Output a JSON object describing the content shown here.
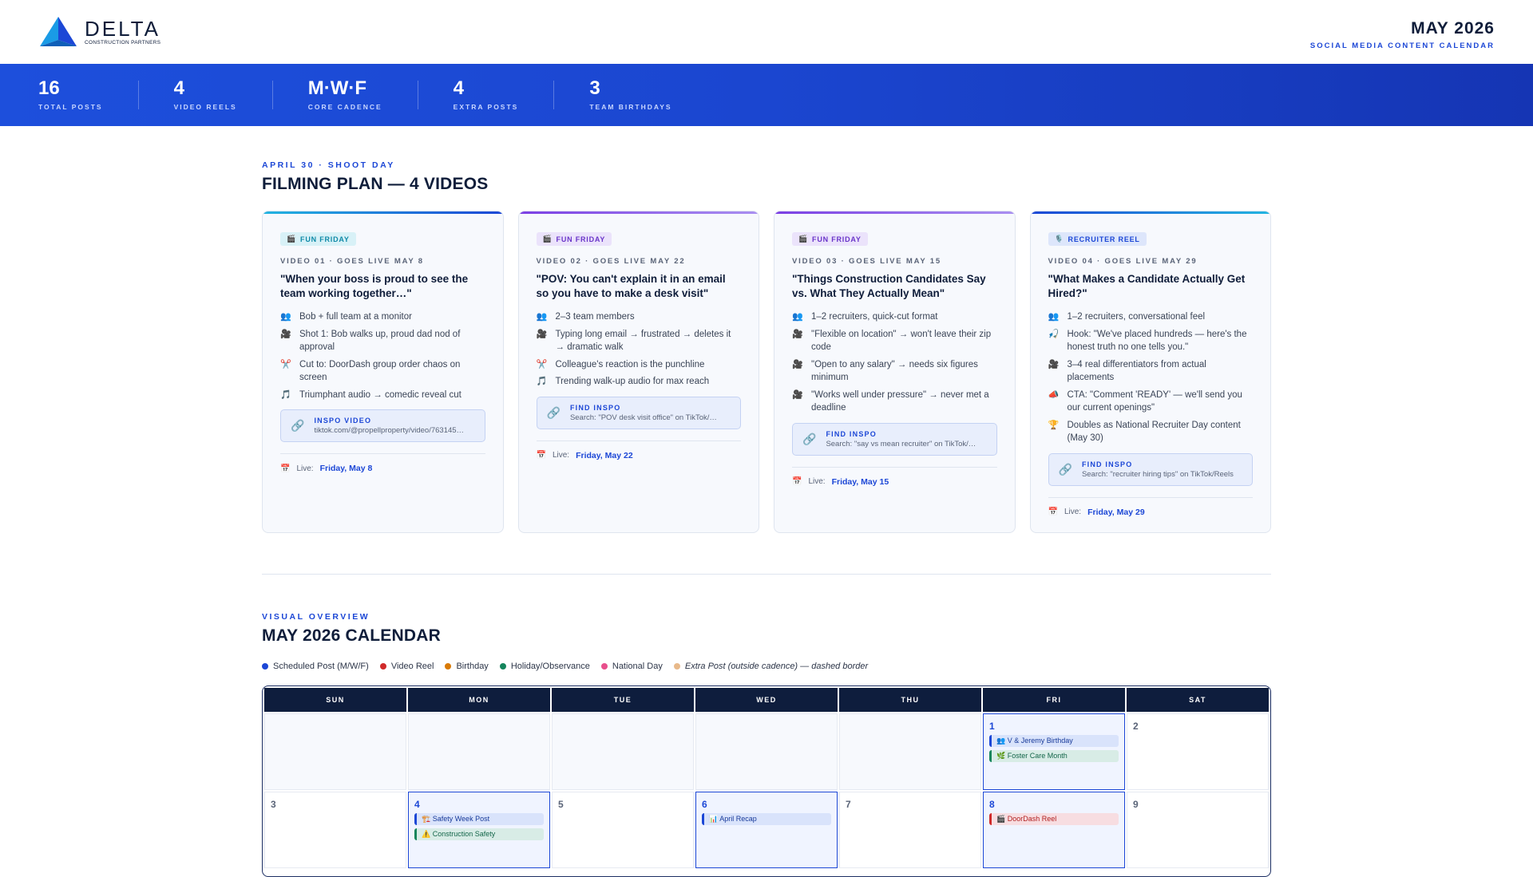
{
  "brand": {
    "name": "DELTA",
    "tagline": "CONSTRUCTION PARTNERS"
  },
  "header": {
    "month": "MAY 2026",
    "subtitle": "SOCIAL MEDIA CONTENT CALENDAR"
  },
  "stats": [
    {
      "value": "16",
      "label": "TOTAL POSTS"
    },
    {
      "value": "4",
      "label": "VIDEO REELS"
    },
    {
      "value": "M·W·F",
      "label": "CORE CADENCE"
    },
    {
      "value": "4",
      "label": "EXTRA POSTS"
    },
    {
      "value": "3",
      "label": "TEAM BIRTHDAYS"
    }
  ],
  "filming": {
    "eyebrow": "APRIL 30 · SHOOT DAY",
    "title": "FILMING PLAN — 4 VIDEOS",
    "live_label": "Live:",
    "cards": [
      {
        "tag": "FUN FRIDAY",
        "meta": "VIDEO 01 · GOES LIVE MAY 8",
        "title": "\"When your boss is proud to see the team working together…\"",
        "bullets": [
          "Bob + full team at a monitor",
          "Shot 1: Bob walks up, proud dad nod of approval",
          "Cut to: DoorDash group order chaos on screen",
          "Triumphant audio → comedic reveal cut"
        ],
        "inspo_label": "INSPO VIDEO",
        "inspo_text": "tiktok.com/@propellproperty/video/763145…",
        "live": "Friday, May 8"
      },
      {
        "tag": "FUN FRIDAY",
        "meta": "VIDEO 02 · GOES LIVE MAY 22",
        "title": "\"POV: You can't explain it in an email so you have to make a desk visit\"",
        "bullets": [
          "2–3 team members",
          "Typing long email → frustrated → deletes it → dramatic walk",
          "Colleague's reaction is the punchline",
          "Trending walk-up audio for max reach"
        ],
        "inspo_label": "FIND INSPO",
        "inspo_text": "Search: \"POV desk visit office\" on TikTok/…",
        "live": "Friday, May 22"
      },
      {
        "tag": "FUN FRIDAY",
        "meta": "VIDEO 03 · GOES LIVE MAY 15",
        "title": "\"Things Construction Candidates Say vs. What They Actually Mean\"",
        "bullets": [
          "1–2 recruiters, quick-cut format",
          "\"Flexible on location\" → won't leave their zip code",
          "\"Open to any salary\" → needs six figures minimum",
          "\"Works well under pressure\" → never met a deadline"
        ],
        "inspo_label": "FIND INSPO",
        "inspo_text": "Search: \"say vs mean recruiter\" on TikTok/…",
        "live": "Friday, May 15"
      },
      {
        "tag": "RECRUITER REEL",
        "meta": "VIDEO 04 · GOES LIVE MAY 29",
        "title": "\"What Makes a Candidate Actually Get Hired?\"",
        "bullets": [
          "1–2 recruiters, conversational feel",
          "Hook: \"We've placed hundreds — here's the honest truth no one tells you.\"",
          "3–4 real differentiators from actual placements",
          "CTA: \"Comment 'READY' — we'll send you our current openings\"",
          "Doubles as National Recruiter Day content (May 30)"
        ],
        "inspo_label": "FIND INSPO",
        "inspo_text": "Search: \"recruiter hiring tips\" on TikTok/Reels",
        "live": "Friday, May 29"
      }
    ]
  },
  "overview": {
    "eyebrow": "VISUAL OVERVIEW",
    "title": "MAY 2026 CALENDAR",
    "legend": [
      {
        "label": "Scheduled Post (M/W/F)",
        "color": "#1c47d6"
      },
      {
        "label": "Video Reel",
        "color": "#d02a2a"
      },
      {
        "label": "Birthday",
        "color": "#d97a06"
      },
      {
        "label": "Holiday/Observance",
        "color": "#14855c"
      },
      {
        "label": "National Day",
        "color": "#e84f8c"
      },
      {
        "label": "Extra Post (outside cadence) — dashed border",
        "color": "#e8b98a"
      }
    ],
    "weekdays": [
      "SUN",
      "MON",
      "TUE",
      "WED",
      "THU",
      "FRI",
      "SAT"
    ],
    "week1": {
      "fri_num": "1",
      "fri_evt1": "👥 V & Jeremy Birthday",
      "fri_evt2": "🌿 Foster Care Month",
      "sat_num": "2"
    },
    "week2": {
      "sun_num": "3",
      "mon_num": "4",
      "mon_evt1": "🏗️ Safety Week Post",
      "mon_evt2": "⚠️ Construction Safety",
      "tue_num": "5",
      "wed_num": "6",
      "wed_evt1": "📊 April Recap",
      "thu_num": "7",
      "fri_num": "8",
      "fri_evt1": "🎬 DoorDash Reel",
      "sat_num": "9"
    }
  },
  "colors": {
    "accent": "#1c47d6",
    "navy": "#0e1d3d",
    "card1_line": "#22b4e0",
    "card2_line": "#7b3fe4",
    "card3_line": "#7b3fe4",
    "card4_line": "#1c47d6"
  }
}
